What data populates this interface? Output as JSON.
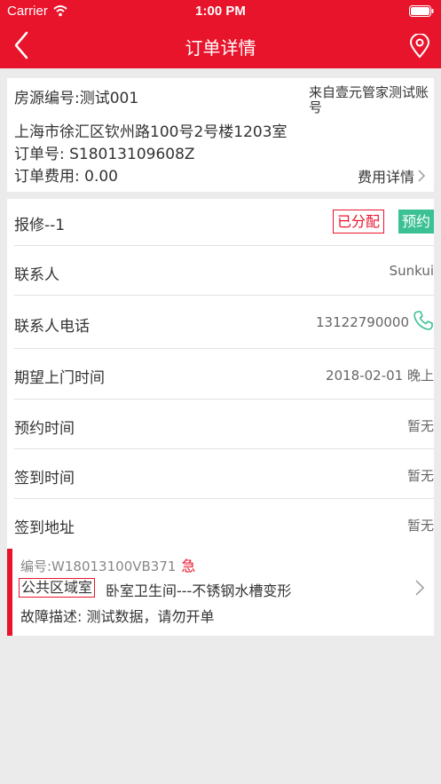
{
  "status_bar": {
    "carrier": "Carrier",
    "time": "1:00 PM"
  },
  "nav": {
    "title": "订单详情"
  },
  "order": {
    "house_code": "房源编号:测试001",
    "source": "来自壹元管家测试账号",
    "address": "上海市徐汇区钦州路100号2号楼1203室",
    "order_no": "订单号: S18013109608Z",
    "fee": "订单费用:  0.00",
    "fee_detail": "费用详情"
  },
  "repair": {
    "title": "报修--1",
    "badge_assigned": "已分配",
    "badge_booking": "预约",
    "rows": [
      {
        "label": "联系人",
        "value": "Sunkui"
      },
      {
        "label": "联系人电话",
        "value": "13122790000"
      },
      {
        "label": "期望上门时间",
        "value": "2018-02-01 晚上"
      },
      {
        "label": "预约时间",
        "value": "暂无"
      },
      {
        "label": "签到时间",
        "value": "暂无"
      },
      {
        "label": "签到地址",
        "value": "暂无"
      }
    ]
  },
  "task": {
    "code": "编号:W18013100VB371",
    "urgent": "急",
    "area_tag": "公共区域室",
    "title": "卧室卫生间---不锈钢水槽变形",
    "description": "故障描述: 测试数据，请勿开单"
  },
  "colors": {
    "brand_red": "#e8142b",
    "booking_green": "#3cc194",
    "phone_green": "#3cc194"
  }
}
